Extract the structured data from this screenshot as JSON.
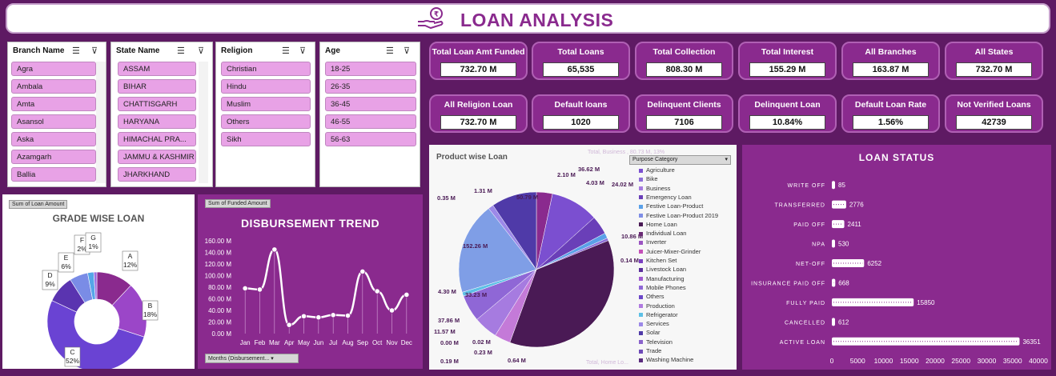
{
  "title": "LOAN ANALYSIS",
  "slicers": {
    "branch": {
      "header": "Branch Name",
      "items": [
        "Agra",
        "Ambala",
        "Amta",
        "Asansol",
        "Aska",
        "Azamgarh",
        "Ballia"
      ]
    },
    "state": {
      "header": "State Name",
      "items": [
        "ASSAM",
        "BIHAR",
        "CHATTISGARH",
        "HARYANA",
        "HIMACHAL PRA...",
        "JAMMU & KASHMIR",
        "JHARKHAND"
      ]
    },
    "religion": {
      "header": "Religion",
      "items": [
        "Christian",
        "Hindu",
        "Muslim",
        "Others",
        "Sikh"
      ]
    },
    "age": {
      "header": "Age",
      "items": [
        "18-25",
        "26-35",
        "36-45",
        "46-55",
        "56-63"
      ]
    }
  },
  "kpis": [
    {
      "label": "Total  Loan Amt  Funded",
      "value": "732.70 M"
    },
    {
      "label": "Total Loans",
      "value": "65,535"
    },
    {
      "label": "Total Collection",
      "value": "808.30 M"
    },
    {
      "label": "Total Interest",
      "value": "155.29 M"
    },
    {
      "label": "All Branches",
      "value": "163.87 M"
    },
    {
      "label": "All States",
      "value": "732.70 M"
    },
    {
      "label": "All Religion Loan",
      "value": "732.70 M"
    },
    {
      "label": "Default loans",
      "value": "1020"
    },
    {
      "label": "Delinquent Clients",
      "value": "7106"
    },
    {
      "label": "Delinquent Loan",
      "value": "10.84%"
    },
    {
      "label": "Default Loan Rate",
      "value": "1.56%"
    },
    {
      "label": "Not Verified Loans",
      "value": "42739"
    }
  ],
  "grade": {
    "field_button": "Sum of Loan Amount",
    "title": "GRADE WISE LOAN",
    "chart_data": {
      "type": "pie",
      "title": "GRADE WISE LOAN",
      "categories": [
        "A",
        "B",
        "C",
        "D",
        "E",
        "F",
        "G"
      ],
      "values": [
        12,
        18,
        52,
        9,
        6,
        2,
        1
      ],
      "labels": [
        "A\n12%",
        "B\n18%",
        "C\n52%",
        "D\n9%",
        "E\n6%",
        "F\n2%",
        "G\n1%"
      ]
    }
  },
  "trend": {
    "field_button": "Sum of Funded Amount",
    "title": "DISBURSEMENT TREND",
    "months_button": "Months (Disbursement...",
    "chart_data": {
      "type": "line",
      "title": "DISBURSEMENT TREND",
      "categories": [
        "Jan",
        "Feb",
        "Mar",
        "Apr",
        "May",
        "Jun",
        "Jul",
        "Aug",
        "Sep",
        "Oct",
        "Nov",
        "Dec"
      ],
      "values": [
        78,
        76,
        145,
        15,
        30,
        28,
        32,
        31,
        107,
        73,
        40,
        67
      ],
      "yticks": [
        "0.00 M",
        "20.00 M",
        "40.00 M",
        "60.00 M",
        "80.00 M",
        "100.00 M",
        "120.00 M",
        "140.00 M",
        "160.00 M"
      ],
      "ylim": [
        0,
        160
      ]
    }
  },
  "product": {
    "title": "Product wise Loan",
    "dropdown": "Purpose  Category",
    "top_label": "Total, Business , 80.73 M, 13%",
    "bottom_label": "Total, Home Lo...",
    "chart_data": {
      "type": "pie",
      "data_labels": [
        "2.10 M",
        "36.62 M",
        "4.03 M",
        "24.02 M",
        "10.86 M",
        "0.14 M",
        "0.35 M",
        "1.31 M",
        "50.79 M",
        "152.26 M",
        "4.30 M",
        "33.23 M",
        "37.86 M",
        "11.57 M",
        "0.00 M",
        "0.23 M",
        "0.02 M",
        "0.19 M",
        "0.64 M"
      ]
    },
    "legend": [
      "Agriculture",
      "Bike",
      "Business",
      "Emergency Loan",
      "Festive Loan-Product",
      "Festive Loan-Product 2019",
      "Home Loan",
      "Individual Loan",
      "Inverter",
      "Juicer-Mixer-Grinder",
      "Kitchen Set",
      "Livestock Loan",
      "Manufacturing",
      "Mobile Phones",
      "Others",
      "Production",
      "Refrigerator",
      "Services",
      "Solar",
      "Television",
      "Trade",
      "Washing Machine"
    ],
    "legend_colors": [
      "#7b4fd0",
      "#8d6ed8",
      "#a67be0",
      "#6a3fb8",
      "#5aa0e8",
      "#7f8ee6",
      "#4a1a55",
      "#6a2a75",
      "#9b54c2",
      "#c44fb8",
      "#7a3ec0",
      "#5b2e9b",
      "#a05ad0",
      "#8f67d6",
      "#6b46c8",
      "#b07ae0",
      "#5dc0e6",
      "#9c89e8",
      "#4f3aa8",
      "#8a63cc",
      "#6e4ab8",
      "#5a2c7e"
    ]
  },
  "status": {
    "title": "LOAN STATUS",
    "chart_data": {
      "type": "bar",
      "categories": [
        "WRITE OFF",
        "TRANSFERRED",
        "PAID OFF",
        "NPA",
        "NET-OFF",
        "INSURANCE PAID OFF",
        "FULLY PAID",
        "CANCELLED",
        "ACTIVE LOAN"
      ],
      "values": [
        85,
        2776,
        2411,
        530,
        6252,
        668,
        15850,
        612,
        36351
      ],
      "value_labels": [
        "85",
        "2776",
        "2411",
        "530",
        "6252",
        "668",
        "15850",
        "612",
        "36351"
      ],
      "xticks": [
        "0",
        "5000",
        "10000",
        "15000",
        "20000",
        "25000",
        "30000",
        "35000",
        "40000"
      ],
      "xlim": [
        0,
        40000
      ]
    }
  }
}
